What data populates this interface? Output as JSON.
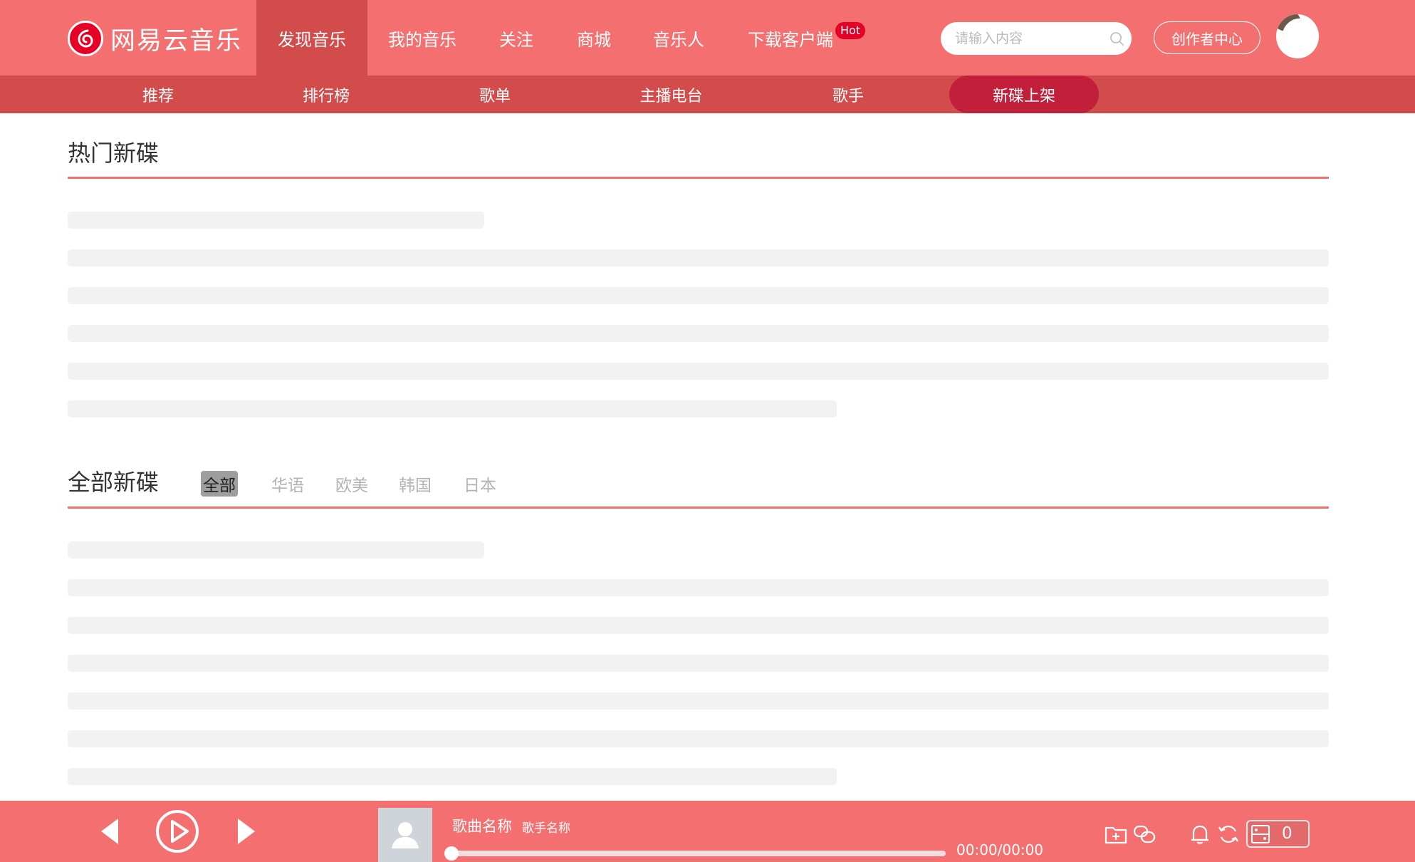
{
  "brand": {
    "name": "网易云音乐"
  },
  "nav": {
    "items": [
      {
        "label": "发现音乐"
      },
      {
        "label": "我的音乐"
      },
      {
        "label": "关注"
      },
      {
        "label": "商城"
      },
      {
        "label": "音乐人"
      },
      {
        "label": "下载客户端"
      }
    ],
    "active": "发现音乐",
    "hot_badge": "Hot"
  },
  "search": {
    "placeholder": "请输入内容",
    "value": "",
    "icon": "search-icon"
  },
  "creator_center": {
    "label": "创作者中心"
  },
  "subnav": {
    "items": [
      {
        "label": "推荐"
      },
      {
        "label": "排行榜"
      },
      {
        "label": "歌单"
      },
      {
        "label": "主播电台"
      },
      {
        "label": "歌手"
      },
      {
        "label": "新碟上架"
      }
    ],
    "active": "新碟上架"
  },
  "hot_albums": {
    "title": "热门新碟"
  },
  "all_albums": {
    "title": "全部新碟",
    "filters": [
      {
        "label": "全部"
      },
      {
        "label": "华语"
      },
      {
        "label": "欧美"
      },
      {
        "label": "韩国"
      },
      {
        "label": "日本"
      }
    ],
    "active_filter": "全部"
  },
  "player": {
    "song_name": "歌曲名称",
    "singer_name": "歌手名称",
    "time": "00:00/00:00",
    "progress": 0,
    "playlist_count": "0"
  },
  "colors": {
    "header": "#f46f6f",
    "subnav": "#d24c4c",
    "active_pill": "#c21f3a",
    "divider": "#f46f6f",
    "skeleton": "#f2f2f2"
  }
}
